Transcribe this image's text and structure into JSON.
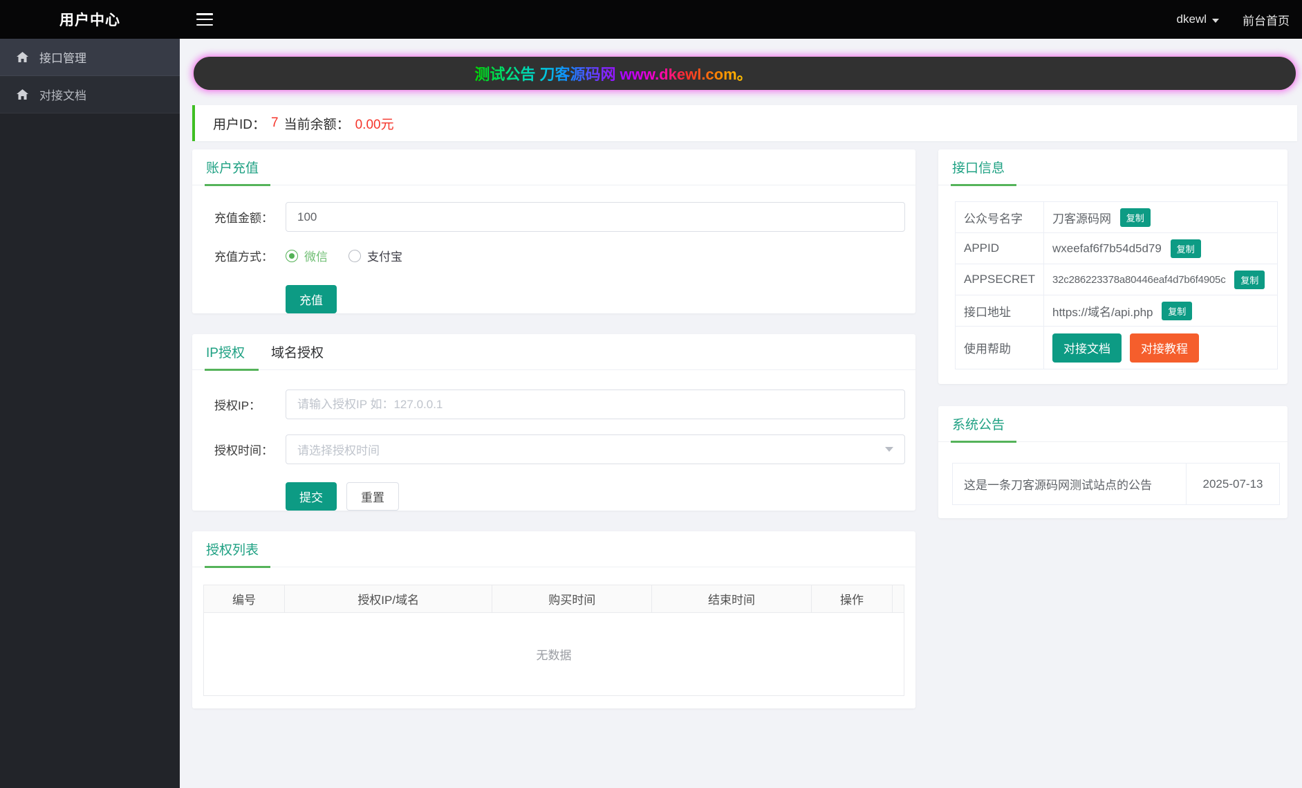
{
  "header": {
    "title": "用户中心",
    "user_menu": "dkewl",
    "home_link": "前台首页"
  },
  "sidebar": {
    "items": [
      {
        "label": "接口管理"
      },
      {
        "label": "对接文档"
      }
    ]
  },
  "banner": {
    "marquee_text": "测试公告 刀客源码网 www.dkewl.com。"
  },
  "user_bar": {
    "id_label": "用户ID：",
    "id_value": "7",
    "balance_label": "当前余额：",
    "balance_value": "0.00元"
  },
  "recharge": {
    "title": "账户充值",
    "amount_label": "充值金额：",
    "amount_value": "100",
    "method_label": "充值方式：",
    "methods": [
      {
        "label": "微信",
        "selected": true
      },
      {
        "label": "支付宝",
        "selected": false
      }
    ],
    "submit_label": "充值"
  },
  "authorize": {
    "tabs": [
      {
        "label": "IP授权",
        "active": true
      },
      {
        "label": "域名授权",
        "active": false
      }
    ],
    "ip_label": "授权IP：",
    "ip_placeholder": "请输入授权IP 如：127.0.0.1",
    "time_label": "授权时间：",
    "time_placeholder": "请选择授权时间",
    "submit_label": "提交",
    "reset_label": "重置"
  },
  "auth_list": {
    "title": "授权列表",
    "columns": [
      "编号",
      "授权IP/域名",
      "购买时间",
      "结束时间",
      "操作"
    ],
    "empty_text": "无数据"
  },
  "api_info": {
    "title": "接口信息",
    "copy_label": "复制",
    "rows": [
      {
        "label": "公众号名字",
        "value": "刀客源码网"
      },
      {
        "label": "APPID",
        "value": "wxeefaf6f7b54d5d79"
      },
      {
        "label": "APPSECRET",
        "value": "32c286223378a80446eaf4d7b6f4905c"
      },
      {
        "label": "接口地址",
        "value": "https://域名/api.php"
      }
    ],
    "help_label": "使用帮助",
    "help_buttons": [
      {
        "label": "对接文档"
      },
      {
        "label": "对接教程"
      }
    ]
  },
  "announcement": {
    "title": "系统公告",
    "rows": [
      {
        "text": "这是一条刀客源码网测试站点的公告",
        "date": "2025-07-13"
      }
    ]
  },
  "colors": {
    "accent_teal": "#0d9b84",
    "title_teal": "#1fa183",
    "underline_green": "#55b35a",
    "bar_green": "#3fbf23",
    "danger_red": "#f5352b",
    "orange": "#f55e2c"
  }
}
